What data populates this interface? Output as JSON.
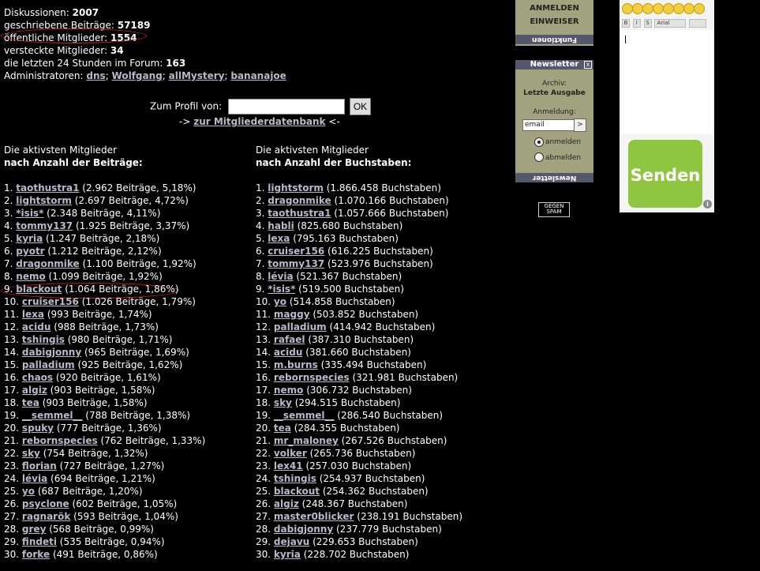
{
  "stats": [
    {
      "label": "Diskussionen:",
      "value": "2007"
    },
    {
      "label": "geschriebene Beiträge:",
      "value": "57189"
    },
    {
      "label": "öffentliche Mitglieder:",
      "value": "1554"
    },
    {
      "label": "versteckte Mitglieder:",
      "value": "34"
    },
    {
      "label": "die letzten 24 Stunden im Forum:",
      "value": "163"
    }
  ],
  "admins": {
    "label": "Administratoren:",
    "names": [
      "dns",
      "Wolfgang",
      "allMystery",
      "bananajoe"
    ],
    "separator": "; "
  },
  "profile": {
    "label": "Zum Profil von:",
    "button": "OK",
    "value": ""
  },
  "db_link": {
    "prefix": "-> ",
    "text": "zur Mitgliederdatenbank",
    "suffix": " <-"
  },
  "left_col": {
    "title1": "Die aktivsten Mitglieder",
    "title2": "nach Anzahl der Beiträge:",
    "items": [
      {
        "rank": "1.",
        "name": "taothustra1",
        "stat": "(2.962 Beiträge, 5,18%)"
      },
      {
        "rank": "2.",
        "name": "lightstorm",
        "stat": "(2.697 Beiträge, 4,72%)"
      },
      {
        "rank": "3.",
        "name": "*isis*",
        "stat": "(2.348 Beiträge, 4,11%)"
      },
      {
        "rank": "4.",
        "name": "tommy137",
        "stat": "(1.925 Beiträge, 3,37%)"
      },
      {
        "rank": "5.",
        "name": "kyria",
        "stat": "(1.247 Beiträge, 2,18%)"
      },
      {
        "rank": "6.",
        "name": "pyotr",
        "stat": "(1.212 Beiträge, 2,12%)"
      },
      {
        "rank": "7.",
        "name": "dragonmike",
        "stat": "(1.100 Beiträge, 1,92%)"
      },
      {
        "rank": "8.",
        "name": "nemo",
        "stat": "(1.099 Beiträge, 1,92%)"
      },
      {
        "rank": "9.",
        "name": "blackout",
        "stat": "(1.064 Beiträge, 1,86%)"
      },
      {
        "rank": "10.",
        "name": "cruiser156",
        "stat": "(1.026 Beiträge, 1,79%)"
      },
      {
        "rank": "11.",
        "name": "lexa",
        "stat": "(993 Beiträge, 1,74%)"
      },
      {
        "rank": "12.",
        "name": "acidu",
        "stat": "(988 Beiträge, 1,73%)"
      },
      {
        "rank": "13.",
        "name": "tshingis",
        "stat": "(980 Beiträge, 1,71%)"
      },
      {
        "rank": "14.",
        "name": "dabigjonny",
        "stat": "(965 Beiträge, 1,69%)"
      },
      {
        "rank": "15.",
        "name": "palladium",
        "stat": "(925 Beiträge, 1,62%)"
      },
      {
        "rank": "16.",
        "name": "chaos",
        "stat": "(920 Beiträge, 1,61%)"
      },
      {
        "rank": "17.",
        "name": "algiz",
        "stat": "(903 Beiträge, 1,58%)"
      },
      {
        "rank": "18.",
        "name": "tea",
        "stat": "(903 Beiträge, 1,58%)"
      },
      {
        "rank": "19.",
        "name": "__semmel__",
        "stat": "(788 Beiträge, 1,38%)"
      },
      {
        "rank": "20.",
        "name": "spuky",
        "stat": "(777 Beiträge, 1,36%)"
      },
      {
        "rank": "21.",
        "name": "rebornspecies",
        "stat": "(762 Beiträge, 1,33%)"
      },
      {
        "rank": "22.",
        "name": "sky",
        "stat": "(754 Beiträge, 1,32%)"
      },
      {
        "rank": "23.",
        "name": "florian",
        "stat": "(727 Beiträge, 1,27%)"
      },
      {
        "rank": "24.",
        "name": "lévia",
        "stat": "(694 Beiträge, 1,21%)"
      },
      {
        "rank": "25.",
        "name": "yo",
        "stat": "(687 Beiträge, 1,20%)"
      },
      {
        "rank": "26.",
        "name": "psyclone",
        "stat": "(602 Beiträge, 1,05%)"
      },
      {
        "rank": "27.",
        "name": "ragnarök",
        "stat": "(593 Beiträge, 1,04%)"
      },
      {
        "rank": "28.",
        "name": "grey",
        "stat": "(568 Beiträge, 0,99%)"
      },
      {
        "rank": "29.",
        "name": "findeti",
        "stat": "(535 Beiträge, 0,94%)"
      },
      {
        "rank": "30.",
        "name": "forke",
        "stat": "(491 Beiträge, 0,86%)"
      }
    ]
  },
  "right_col": {
    "title1": "Die aktivsten Mitglieder",
    "title2": "nach Anzahl der Buchstaben:",
    "items": [
      {
        "rank": "1.",
        "name": "lightstorm",
        "stat": "(1.866.458 Buchstaben)"
      },
      {
        "rank": "2.",
        "name": "dragonmike",
        "stat": "(1.070.166 Buchstaben)"
      },
      {
        "rank": "3.",
        "name": "taothustra1",
        "stat": "(1.057.666 Buchstaben)"
      },
      {
        "rank": "4.",
        "name": "habli",
        "stat": "(825.680 Buchstaben)"
      },
      {
        "rank": "5.",
        "name": "lexa",
        "stat": "(795.163 Buchstaben)"
      },
      {
        "rank": "6.",
        "name": "cruiser156",
        "stat": "(616.225 Buchstaben)"
      },
      {
        "rank": "7.",
        "name": "tommy137",
        "stat": "(523.976 Buchstaben)"
      },
      {
        "rank": "8.",
        "name": "lévia",
        "stat": "(521.367 Buchstaben)"
      },
      {
        "rank": "9.",
        "name": "*isis*",
        "stat": "(519.500 Buchstaben)"
      },
      {
        "rank": "10.",
        "name": "yo",
        "stat": "(514.858 Buchstaben)"
      },
      {
        "rank": "11.",
        "name": "maggy",
        "stat": "(503.852 Buchstaben)"
      },
      {
        "rank": "12.",
        "name": "palladium",
        "stat": "(414.942 Buchstaben)"
      },
      {
        "rank": "13.",
        "name": "rafael",
        "stat": "(387.310 Buchstaben)"
      },
      {
        "rank": "14.",
        "name": "acidu",
        "stat": "(381.660 Buchstaben)"
      },
      {
        "rank": "15.",
        "name": "m.burns",
        "stat": "(335.494 Buchstaben)"
      },
      {
        "rank": "16.",
        "name": "rebornspecies",
        "stat": "(321.981 Buchstaben)"
      },
      {
        "rank": "17.",
        "name": "nemo",
        "stat": "(306.732 Buchstaben)"
      },
      {
        "rank": "18.",
        "name": "sky",
        "stat": "(294.515 Buchstaben)"
      },
      {
        "rank": "19.",
        "name": "__semmel__",
        "stat": "(286.540 Buchstaben)"
      },
      {
        "rank": "20.",
        "name": "tea",
        "stat": "(284.355 Buchstaben)"
      },
      {
        "rank": "21.",
        "name": "mr_maloney",
        "stat": "(267.526 Buchstaben)"
      },
      {
        "rank": "22.",
        "name": "volker",
        "stat": "(265.736 Buchstaben)"
      },
      {
        "rank": "23.",
        "name": "lex41",
        "stat": "(257.030 Buchstaben)"
      },
      {
        "rank": "24.",
        "name": "tshingis",
        "stat": "(254.937 Buchstaben)"
      },
      {
        "rank": "25.",
        "name": "blackout",
        "stat": "(254.362 Buchstaben)"
      },
      {
        "rank": "26.",
        "name": "algiz",
        "stat": "(248.367 Buchstaben)"
      },
      {
        "rank": "27.",
        "name": "master0blicker",
        "stat": "(238.191 Buchstaben)"
      },
      {
        "rank": "28.",
        "name": "dabigjonny",
        "stat": "(237.779 Buchstaben)"
      },
      {
        "rank": "29.",
        "name": "dejavu",
        "stat": "(229.653 Buchstaben)"
      },
      {
        "rank": "30.",
        "name": "kyria",
        "stat": "(228.702 Buchstaben)"
      }
    ]
  },
  "functions_panel": {
    "items": [
      "ANMELDEN",
      "EINWEISER"
    ],
    "tab": "Funktionen"
  },
  "newsletter": {
    "title": "Newsletter",
    "close": "x",
    "archive_label": "Archiv:",
    "archive_link": "Letzte Ausgabe",
    "signup_label": "Anmeldung:",
    "email_value": "email",
    "go_button": ">",
    "options": [
      {
        "label": "anmelden",
        "selected": true
      },
      {
        "label": "abmelden",
        "selected": false
      }
    ],
    "tab": "Newsletter"
  },
  "spam_badge": {
    "line1": "GEGEN",
    "line2": "SPAM"
  },
  "editor": {
    "tools": [
      "B",
      "I",
      "S"
    ],
    "font_select": "Arial",
    "send_button": "Senden",
    "info_icon": "i"
  },
  "colors": {
    "background": "#000000",
    "text": "#ffffff",
    "link": "#b9b9c9",
    "annotation": "#cc1b1b",
    "panel": "#a3a27e",
    "send": "#8ec63f"
  }
}
